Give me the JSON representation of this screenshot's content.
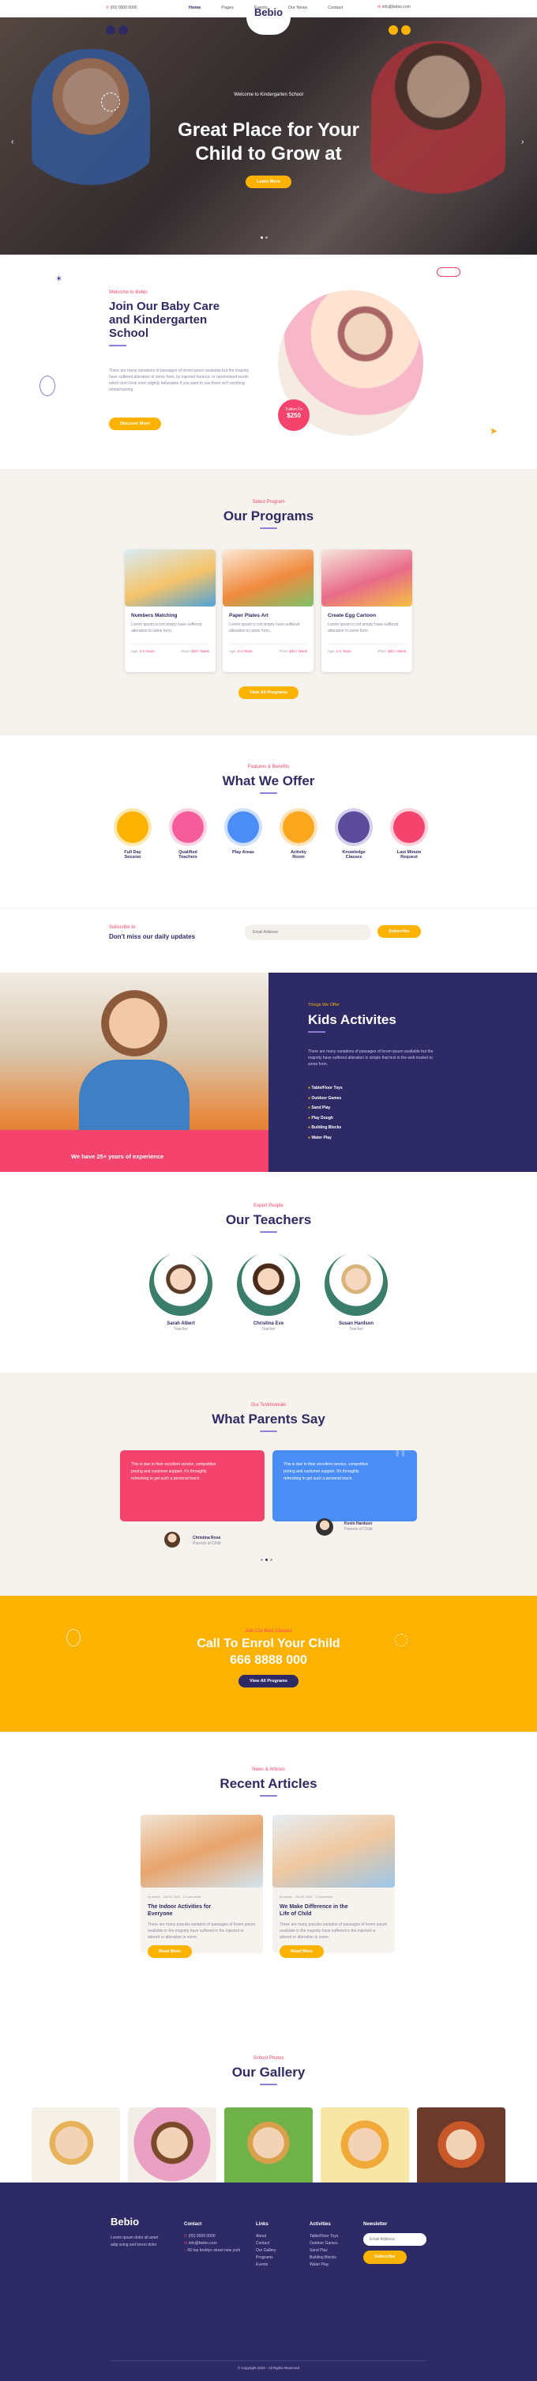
{
  "topbar": {
    "phone": "(00) 0000 0000",
    "email": "info@bebio.com",
    "nav": [
      "Home",
      "Pages",
      "Events",
      "Our News",
      "Contact"
    ],
    "logo": "Bebio"
  },
  "hero": {
    "subtitle": "Welcome to Kindergarten School",
    "title_line1": "Great Place for Your",
    "title_line2": "Child to Grow at",
    "button": "Learn More"
  },
  "about": {
    "sub": "Welcome to Bebio",
    "title_line1": "Join Our Baby Care",
    "title_line2": "and Kindergarten",
    "title_line3": "School",
    "text": "There are many variations of passages of lorem ipsum available but the majority have suffered alteration in some form, by injected humour, or randomised words which don't look even slightly believable if you want to use there isn't anything embarrassing.",
    "button": "Discover More",
    "badge_label": "Tuition Fe",
    "badge_value": "$250"
  },
  "programs": {
    "sub": "Select Program",
    "title": "Our Programs",
    "button": "View All Programs",
    "items": [
      {
        "title": "Numbers Matching",
        "text": "Lorem ipsum is not simply have suffered alteration in some form.",
        "age_label": "Age:",
        "age": "2-4 Years",
        "price_label": "Price:",
        "price": "$40 / Week"
      },
      {
        "title": "Paper Plates Art",
        "text": "Lorem ipsum is not simply have suffered alteration in some form.",
        "age_label": "Age:",
        "age": "3-4 Years",
        "price_label": "Price:",
        "price": "$40 / Week"
      },
      {
        "title": "Create Egg Cartoon",
        "text": "Lorem ipsum is not simply have suffered alteration in some form.",
        "age_label": "Age:",
        "age": "2-4 Years",
        "price_label": "Price:",
        "price": "$40 / Week"
      }
    ]
  },
  "offer": {
    "sub": "Features & Benefits",
    "title": "What We Offer",
    "items": [
      {
        "l1": "Full Day",
        "l2": "Session",
        "color": "#fbb200"
      },
      {
        "l1": "Qualified",
        "l2": "Teachers",
        "color": "#f65c9a"
      },
      {
        "l1": "Play Areas",
        "l2": "",
        "color": "#4a8df6"
      },
      {
        "l1": "Activity",
        "l2": "Room",
        "color": "#fba71d"
      },
      {
        "l1": "Knowledge",
        "l2": "Classes",
        "color": "#5b4b9a"
      },
      {
        "l1": "Last Minute",
        "l2": "Request",
        "color": "#f4436c"
      }
    ]
  },
  "subscribe": {
    "sub": "Subscribe to",
    "title": "Don't miss our daily updates",
    "placeholder": "Email Address",
    "button": "Subscribe"
  },
  "kids": {
    "sub": "Things We Offer",
    "title": "Kids Activites",
    "text": "There are many variations of passages of lorem ipsum available but the majority have suffered alteration in simple that text in the web market to some form.",
    "items": [
      "Table/Floor Toys",
      "Outdoor Games",
      "Sand Play",
      "Play Dough",
      "Building Blocks",
      "Water Play"
    ],
    "banner": "We have 25+ years of experience"
  },
  "teachers": {
    "sub": "Expert People",
    "title": "Our Teachers",
    "items": [
      {
        "name": "Sarah Albert",
        "role": "Teacher"
      },
      {
        "name": "Christina Eve",
        "role": "Teacher"
      },
      {
        "name": "Susan Hardson",
        "role": "Teacher"
      }
    ]
  },
  "testimonials": {
    "sub": "Our Testimonials",
    "title": "What Parents Say",
    "items": [
      {
        "text": "This is due to their excellent service, competitive pricing and customer support. It's throughly refreshing to get such a personal touch.",
        "name": "Christina Rose",
        "role": "Parents of Child"
      },
      {
        "text": "This is due to their excellent service, competitive pricing and customer support. It's throughly refreshing to get such a personal touch.",
        "name": "Kevin Hardson",
        "role": "Parents of Child"
      }
    ]
  },
  "enrol": {
    "sub": "Join Our Best Classes",
    "title": "Call To Enrol Your Child",
    "phone": "666 8888 000",
    "button": "View All Programs"
  },
  "articles": {
    "sub": "News & Articles",
    "title": "Recent Articles",
    "items": [
      {
        "author": "by admin",
        "date": "Oct 02 2020",
        "comments": "2 Comments",
        "title_l1": "The Indoor Activities for",
        "title_l2": "Everyone",
        "text": "There are many popular variation of passages of lorem ipsum available in the majority have suffered in the injected or altered or alteration in some.",
        "button": "Read More"
      },
      {
        "author": "by admin",
        "date": "Oct 02 2020",
        "comments": "2 Comments",
        "title_l1": "We Make Difference in the",
        "title_l2": "Life of Child",
        "text": "There are many popular variation of passages of lorem ipsum available in the majority have suffered in the injected or altered or alteration in some.",
        "button": "Read More"
      }
    ]
  },
  "gallery": {
    "sub": "School Photos",
    "title": "Our Gallery"
  },
  "footer": {
    "logo": "Bebio",
    "about": "Lorem ipsum dolor sit amet adip scing sed lorem dolor",
    "contact_title": "Contact",
    "phone": "(00) 0000 0000",
    "email": "info@bebio.com",
    "address": "66 top broklyn street new york",
    "links_title": "Links",
    "links": [
      "About",
      "Contact",
      "Our Gallery",
      "Programs",
      "Events"
    ],
    "activities_title": "Activities",
    "activities": [
      "Table/Floor Toys",
      "Outdoor Games",
      "Sand Play",
      "Building Blocks",
      "Water Play"
    ],
    "newsletter_title": "Newsletter",
    "newsletter_placeholder": "Email Address",
    "newsletter_button": "Subscribe",
    "copyright": "© Copyright 2020 - All Rights Reserved"
  }
}
